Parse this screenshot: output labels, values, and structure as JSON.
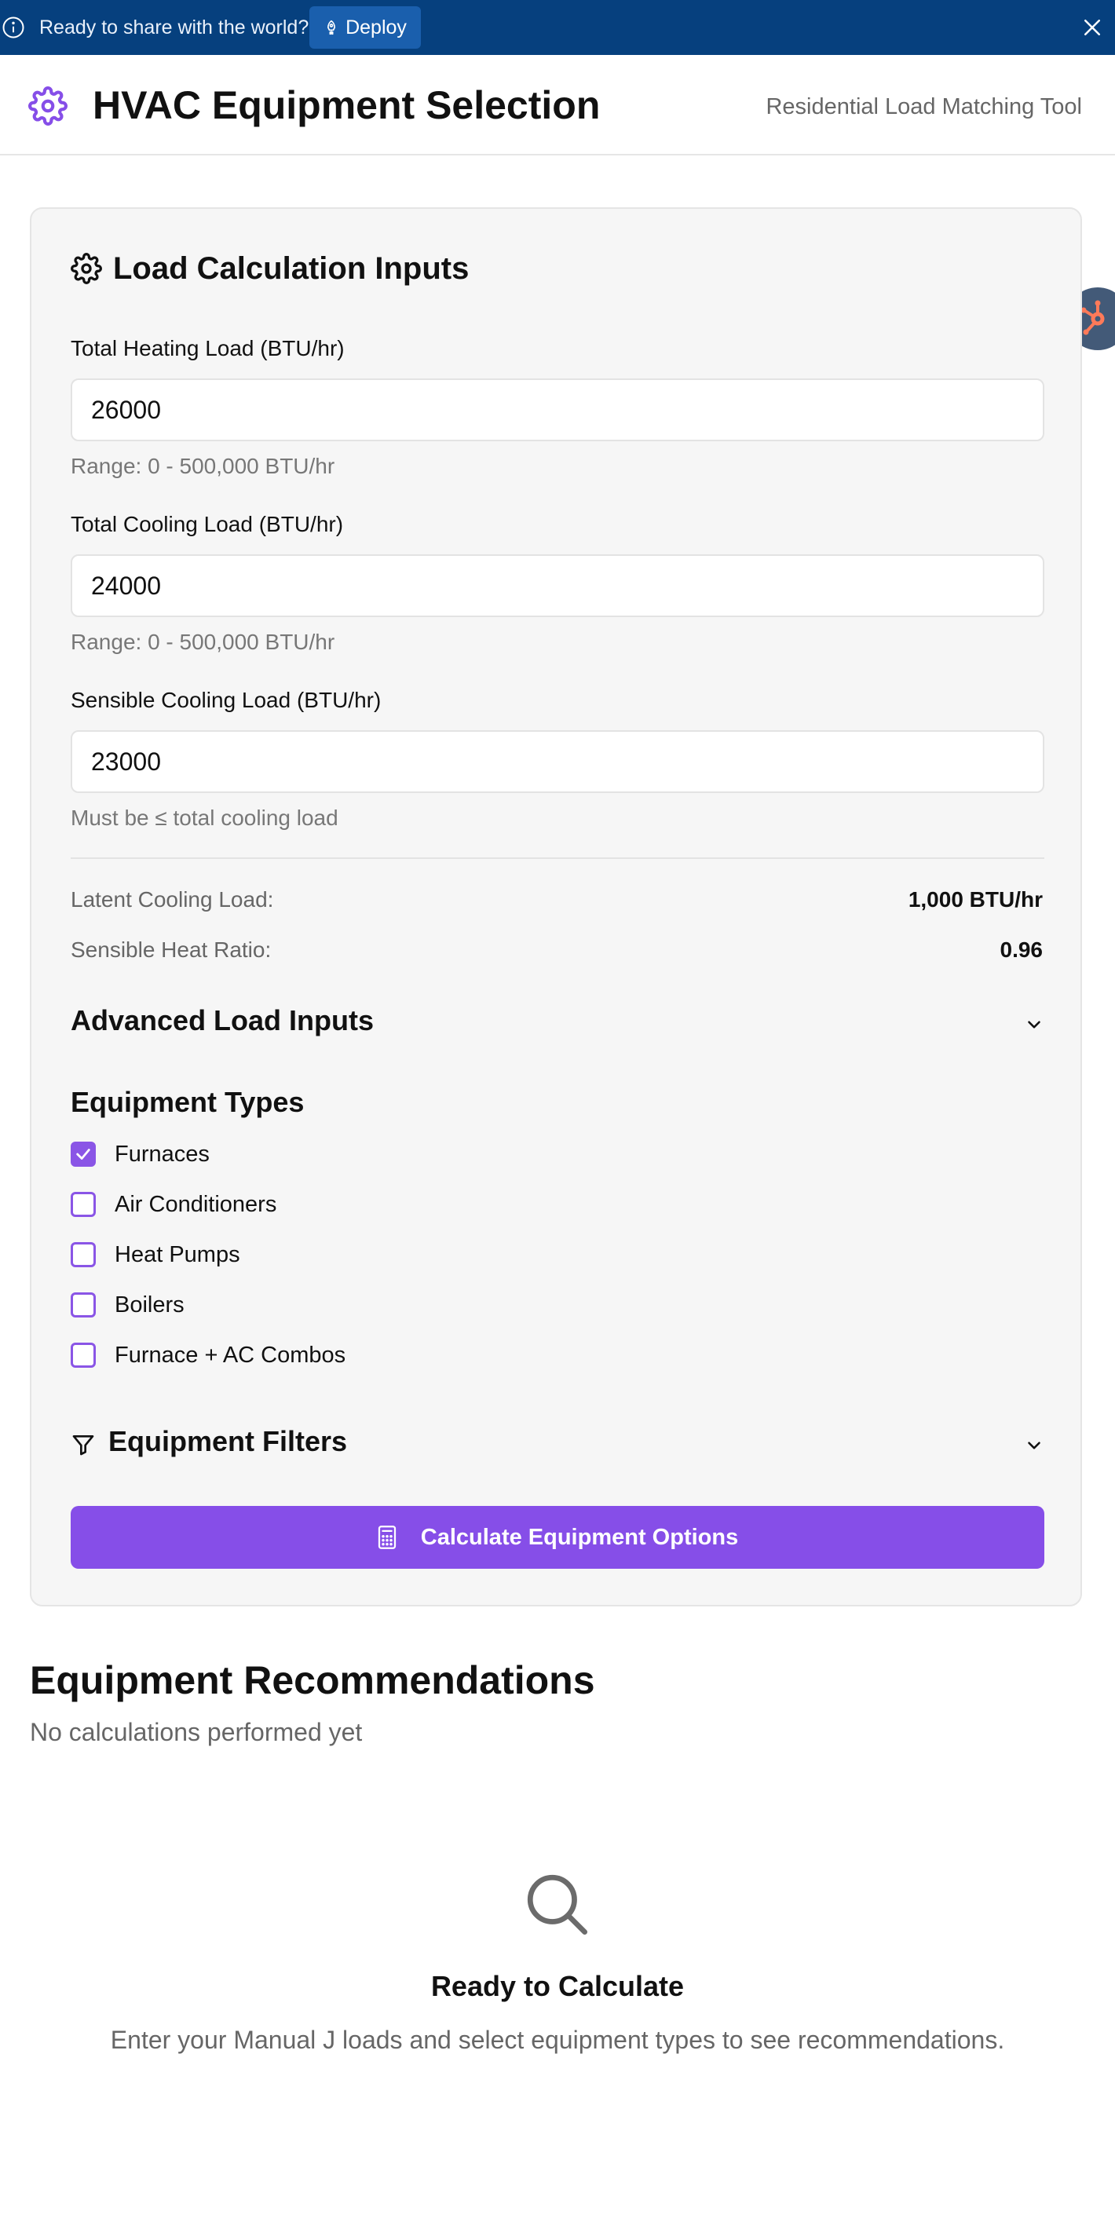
{
  "banner": {
    "text": "Ready to share with the world?",
    "deploy_label": "Deploy"
  },
  "header": {
    "title": "HVAC Equipment Selection",
    "subtitle": "Residential Load Matching Tool"
  },
  "inputs_card": {
    "title": "Load Calculation Inputs",
    "heating": {
      "label": "Total Heating Load (BTU/hr)",
      "value": "26000",
      "help": "Range: 0 - 500,000 BTU/hr"
    },
    "cooling": {
      "label": "Total Cooling Load (BTU/hr)",
      "value": "24000",
      "help": "Range: 0 - 500,000 BTU/hr"
    },
    "sensible": {
      "label": "Sensible Cooling Load (BTU/hr)",
      "value": "23000",
      "help": "Must be ≤ total cooling load"
    },
    "latent_label": "Latent Cooling Load:",
    "latent_value": "1,000 BTU/hr",
    "shr_label": "Sensible Heat Ratio:",
    "shr_value": "0.96",
    "advanced_title": "Advanced Load Inputs",
    "equipment_types_title": "Equipment Types",
    "equipment_types": [
      {
        "label": "Furnaces",
        "checked": true
      },
      {
        "label": "Air Conditioners",
        "checked": false
      },
      {
        "label": "Heat Pumps",
        "checked": false
      },
      {
        "label": "Boilers",
        "checked": false
      },
      {
        "label": "Furnace + AC Combos",
        "checked": false
      }
    ],
    "filters_title": "Equipment Filters",
    "calculate_label": "Calculate Equipment Options"
  },
  "recommendations": {
    "title": "Equipment Recommendations",
    "subtitle": "No calculations performed yet",
    "empty_title": "Ready to Calculate",
    "empty_desc": "Enter your Manual J loads and select equipment types to see recommendations."
  },
  "colors": {
    "banner_bg": "#06407e",
    "accent": "#864ee8",
    "floating_widget": "#435a78",
    "floating_widget_icon": "#ff7a59"
  },
  "icons": {
    "banner_info": "info-icon",
    "deploy": "rocket-icon",
    "banner_close": "close-icon",
    "logo": "gear-icon",
    "card_title": "gear-icon",
    "advanced_toggle": "chevron-down-icon",
    "filters": "filter-icon",
    "filters_toggle": "chevron-down-icon",
    "calculate": "calculator-icon",
    "empty_state": "search-icon",
    "floating_widget": "hubspot-icon"
  }
}
